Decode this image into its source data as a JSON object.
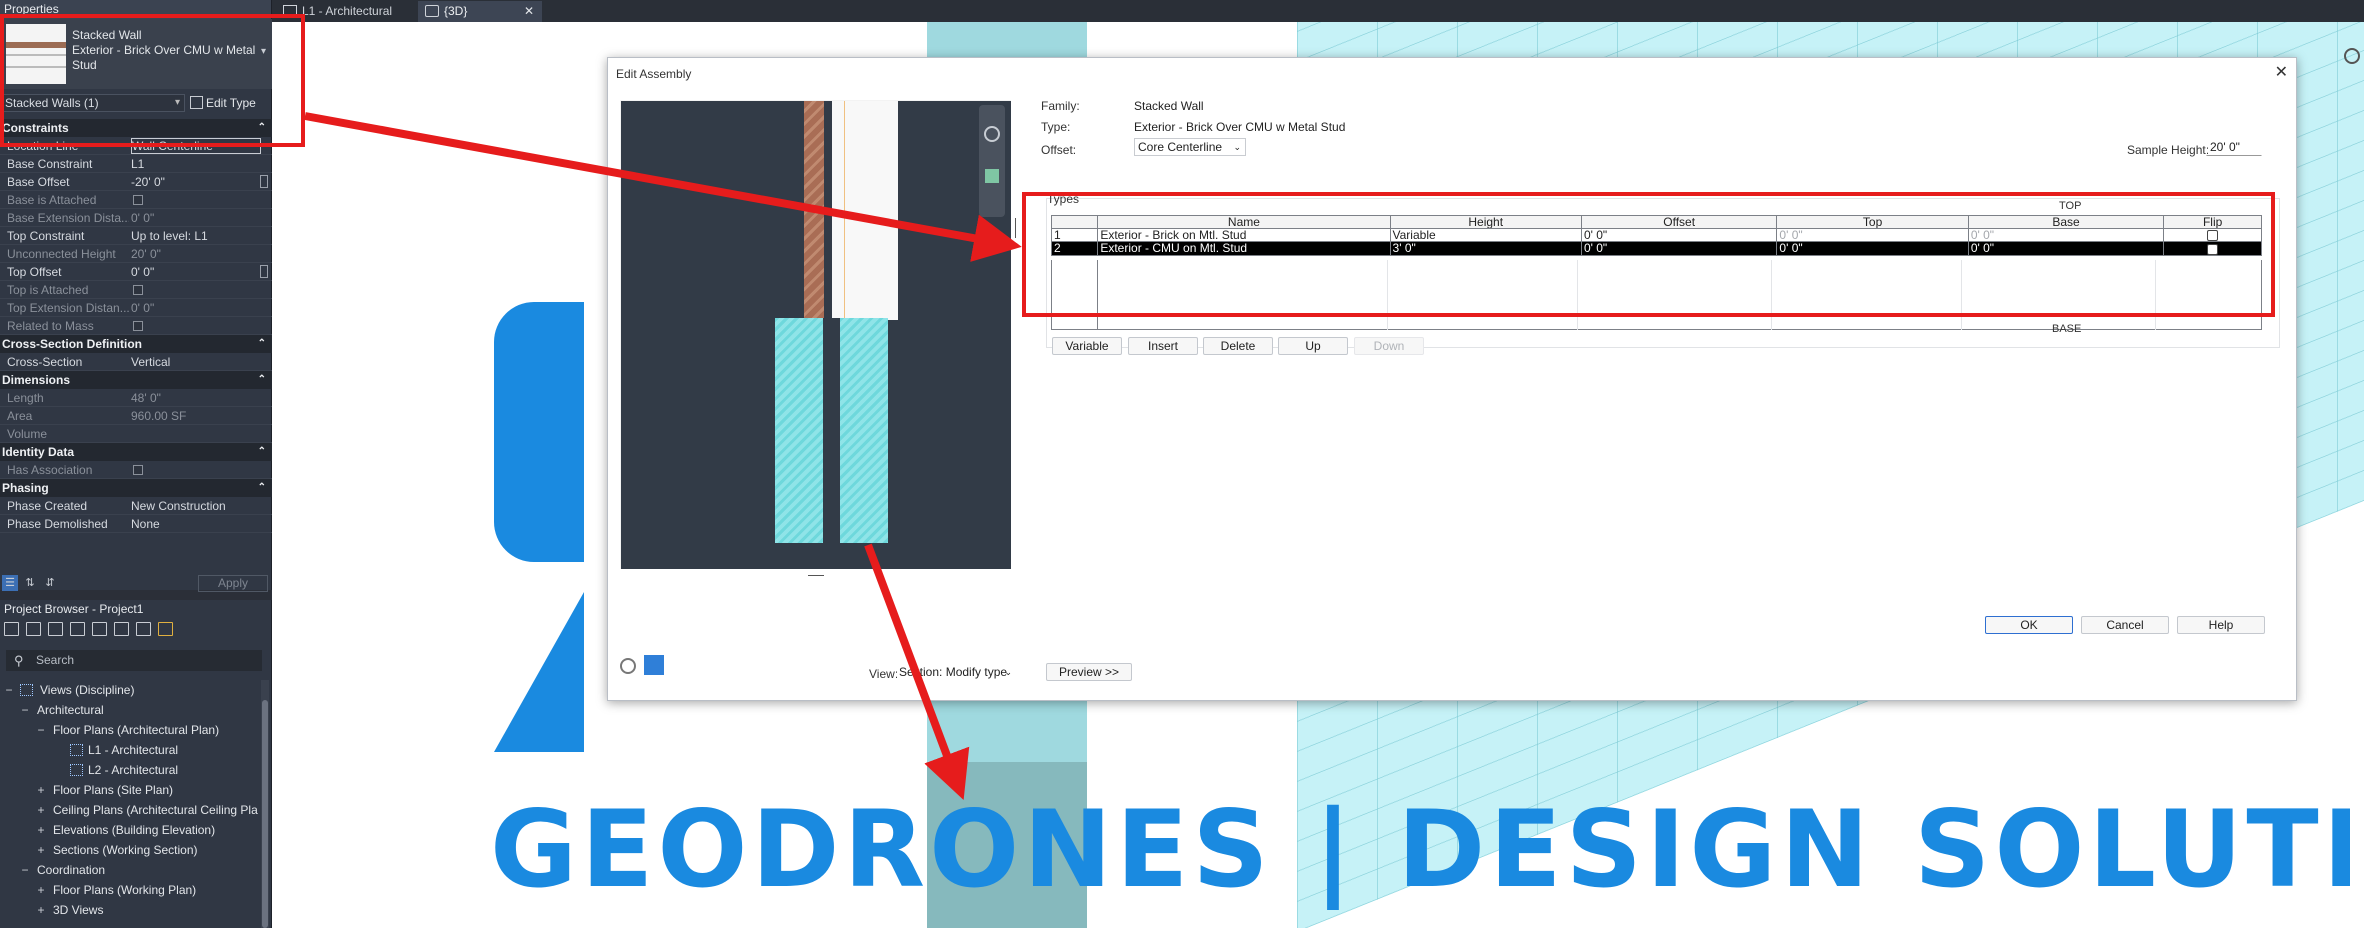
{
  "properties": {
    "title": "Properties",
    "type_family": "Stacked Wall",
    "type_name": "Exterior - Brick Over CMU w Metal Stud",
    "filter": "Stacked Walls (1)",
    "edit_type": "Edit Type",
    "sections": [
      {
        "name": "Constraints",
        "rows": [
          {
            "k": "Location Line",
            "v": "Wall Centerline"
          },
          {
            "k": "Base Constraint",
            "v": "L1"
          },
          {
            "k": "Base Offset",
            "v": "-20'  0\""
          },
          {
            "k": "Base is Attached",
            "v": ""
          },
          {
            "k": "Base Extension Dista...",
            "v": "0'  0\""
          },
          {
            "k": "Top Constraint",
            "v": "Up to level: L1"
          },
          {
            "k": "Unconnected Height",
            "v": "20'  0\""
          },
          {
            "k": "Top Offset",
            "v": "0'  0\""
          },
          {
            "k": "Top is Attached",
            "v": ""
          },
          {
            "k": "Top Extension Distan...",
            "v": "0'  0\""
          },
          {
            "k": "Related to Mass",
            "v": ""
          }
        ]
      },
      {
        "name": "Cross-Section Definition",
        "rows": [
          {
            "k": "Cross-Section",
            "v": "Vertical"
          }
        ]
      },
      {
        "name": "Dimensions",
        "rows": [
          {
            "k": "Length",
            "v": "48'  0\""
          },
          {
            "k": "Area",
            "v": "960.00 SF"
          },
          {
            "k": "Volume",
            "v": ""
          }
        ]
      },
      {
        "name": "Identity Data",
        "rows": [
          {
            "k": "Has Association",
            "v": ""
          }
        ]
      },
      {
        "name": "Phasing",
        "rows": [
          {
            "k": "Phase Created",
            "v": "New Construction"
          },
          {
            "k": "Phase Demolished",
            "v": "None"
          }
        ]
      }
    ],
    "apply": "Apply"
  },
  "browser": {
    "title": "Project Browser - Project1",
    "search_placeholder": "Search",
    "tree": [
      {
        "label": "Views (Discipline)",
        "pm": "−"
      },
      {
        "label": "Architectural",
        "pm": "−"
      },
      {
        "label": "Floor Plans (Architectural Plan)",
        "pm": "−"
      },
      {
        "label": "L1 - Architectural",
        "pm": ""
      },
      {
        "label": "L2 - Architectural",
        "pm": ""
      },
      {
        "label": "Floor Plans (Site Plan)",
        "pm": "+"
      },
      {
        "label": "Ceiling Plans (Architectural Ceiling Pla",
        "pm": "+"
      },
      {
        "label": "Elevations (Building Elevation)",
        "pm": "+"
      },
      {
        "label": "Sections (Working Section)",
        "pm": "+"
      },
      {
        "label": "Coordination",
        "pm": "−"
      },
      {
        "label": "Floor Plans (Working Plan)",
        "pm": "+"
      },
      {
        "label": "3D Views",
        "pm": "+"
      }
    ]
  },
  "tabs": [
    {
      "label": "L1 - Architectural"
    },
    {
      "label": "{3D}",
      "close": "✕"
    }
  ],
  "logo_text": "GEODRONES  |  DESIGN SOLUTIONS",
  "dialog": {
    "title": "Edit Assembly",
    "close": "✕",
    "family_label": "Family:",
    "family_value": "Stacked Wall",
    "type_label": "Type:",
    "type_value": "Exterior - Brick Over CMU w Metal Stud",
    "offset_label": "Offset:",
    "offset_value": "Core Centerline",
    "sample_height_label": "Sample Height:",
    "sample_height_value": "20'  0\"",
    "types_label": "Types",
    "top_label": "TOP",
    "base_label": "BASE",
    "columns": [
      "",
      "Name",
      "Height",
      "Offset",
      "Top",
      "Base",
      "Flip"
    ],
    "rows": [
      {
        "n": "1",
        "name": "Exterior - Brick on Mtl. Stud",
        "height": "Variable",
        "offset": "0'  0\"",
        "top": "0'  0\"",
        "base": "0'  0\"",
        "selected": false
      },
      {
        "n": "2",
        "name": "Exterior - CMU on Mtl. Stud",
        "height": "3'  0\"",
        "offset": "0'  0\"",
        "top": "0'  0\"",
        "base": "0'  0\"",
        "selected": true
      }
    ],
    "buttons": {
      "variable": "Variable",
      "insert": "Insert",
      "delete": "Delete",
      "up": "Up",
      "down": "Down",
      "ok": "OK",
      "cancel": "Cancel",
      "help": "Help",
      "preview": "Preview >>"
    },
    "view_label": "View:",
    "view_value": "Section: Modify type"
  },
  "colors": {
    "annotation_red": "#e61c1c",
    "logo_blue": "#1a8ae0",
    "panel_bg": "#303744"
  }
}
